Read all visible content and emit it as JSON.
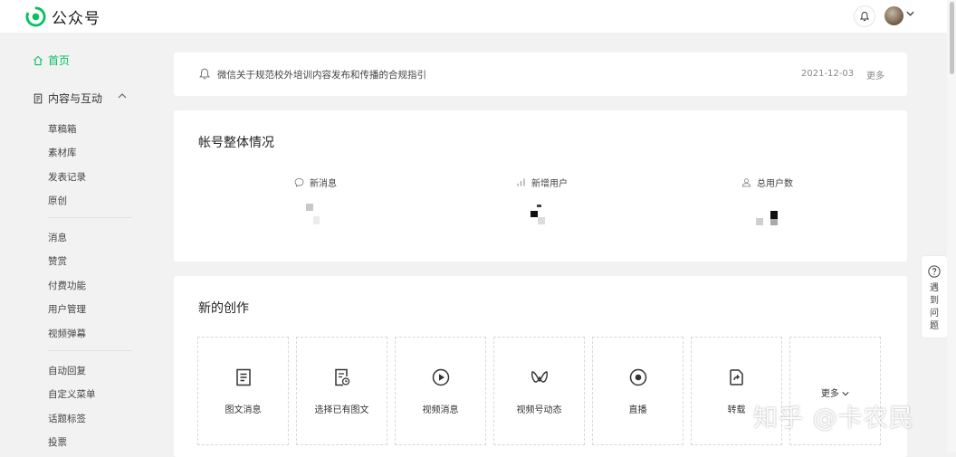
{
  "header": {
    "app_title": "公众号"
  },
  "sidebar": {
    "home": "首页",
    "group_title": "内容与互动",
    "group_items": [
      "草稿箱",
      "素材库",
      "发表记录",
      "原创"
    ],
    "section2": [
      "消息",
      "赞赏",
      "付费功能",
      "用户管理",
      "视频弹幕"
    ],
    "section3": [
      "自动回复",
      "自定义菜单",
      "话题标签",
      "投票"
    ]
  },
  "notice": {
    "text": "微信关于规范校外培训内容发布和传播的合规指引",
    "date": "2021-12-03",
    "more": "更多"
  },
  "overview": {
    "title": "帐号整体情况",
    "stats": [
      {
        "label": "新消息",
        "icon": "chat-bubble-icon"
      },
      {
        "label": "新增用户",
        "icon": "bar-chart-icon"
      },
      {
        "label": "总用户数",
        "icon": "user-icon"
      }
    ]
  },
  "create": {
    "title": "新的创作",
    "items": [
      {
        "label": "图文消息",
        "icon": "document-icon"
      },
      {
        "label": "选择已有图文",
        "icon": "document-clock-icon"
      },
      {
        "label": "视频消息",
        "icon": "play-circle-icon"
      },
      {
        "label": "视频号动态",
        "icon": "channels-icon"
      },
      {
        "label": "直播",
        "icon": "live-icon"
      },
      {
        "label": "转载",
        "icon": "share-icon"
      }
    ],
    "more": "更多"
  },
  "help": {
    "text": "遇到问题"
  },
  "watermark": "知乎 @卡农民",
  "colors": {
    "brand": "#07c160",
    "page_bg": "#f2f2f3"
  }
}
